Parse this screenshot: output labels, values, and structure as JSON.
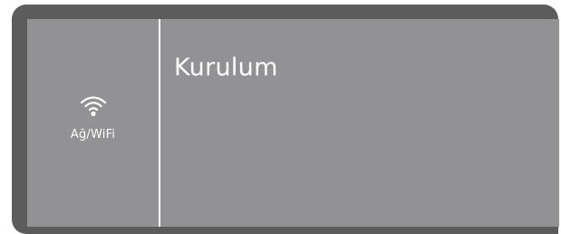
{
  "sidebar": {
    "items": [
      {
        "label": "Ağ/WiFi",
        "icon": "wifi-icon"
      }
    ]
  },
  "main": {
    "title": "Kurulum"
  },
  "colors": {
    "bezel": "#5c5c5c",
    "screen": "#929294",
    "text": "#ffffff"
  }
}
